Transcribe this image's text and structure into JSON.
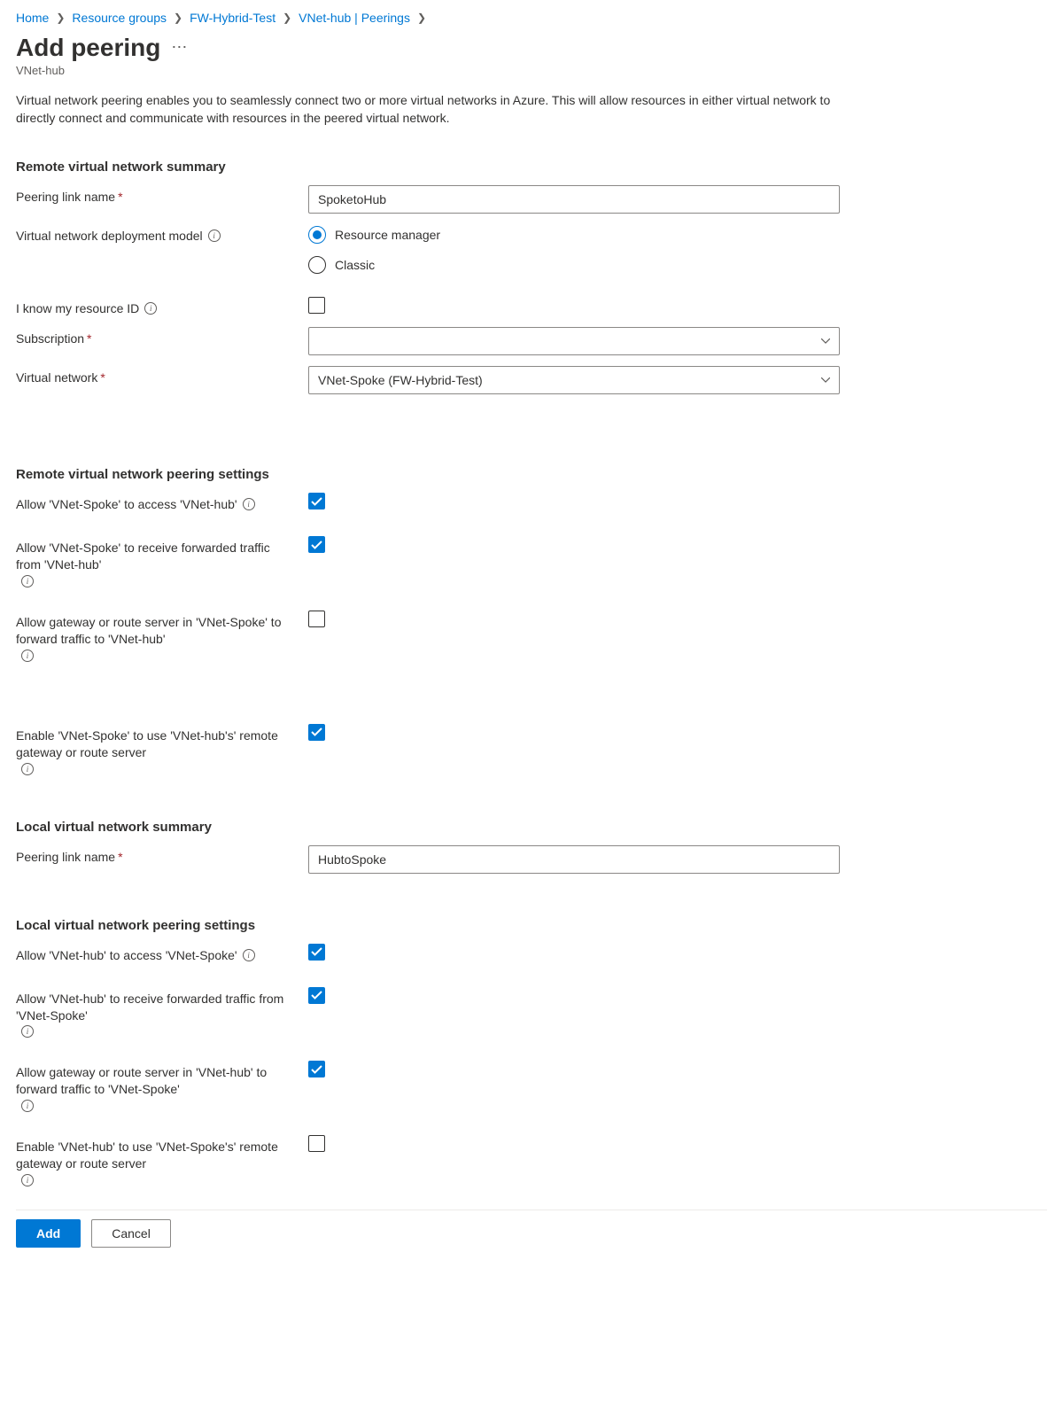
{
  "breadcrumb": [
    {
      "label": "Home"
    },
    {
      "label": "Resource groups"
    },
    {
      "label": "FW-Hybrid-Test"
    },
    {
      "label": "VNet-hub | Peerings"
    }
  ],
  "title": "Add peering",
  "subtitle": "VNet-hub",
  "description": "Virtual network peering enables you to seamlessly connect two or more virtual networks in Azure. This will allow resources in either virtual network to directly connect and communicate with resources in the peered virtual network.",
  "remote_summary": {
    "heading": "Remote virtual network summary",
    "peering_link_label": "Peering link name",
    "peering_link_value": "SpoketoHub",
    "deploy_model_label": "Virtual network deployment model",
    "deploy_model_options": {
      "rm": "Resource manager",
      "classic": "Classic"
    },
    "deploy_model_selected": "rm",
    "know_resource_label": "I know my resource ID",
    "subscription_label": "Subscription",
    "subscription_value": "",
    "vnet_label": "Virtual network",
    "vnet_value": "VNet-Spoke (FW-Hybrid-Test)"
  },
  "remote_settings": {
    "heading": "Remote virtual network peering settings",
    "allow_access_label": "Allow 'VNet-Spoke' to access 'VNet-hub'",
    "allow_access_checked": true,
    "allow_forward_label": "Allow 'VNet-Spoke' to receive forwarded traffic from 'VNet-hub'",
    "allow_forward_checked": true,
    "allow_gateway_label": "Allow gateway or route server in 'VNet-Spoke' to forward traffic to 'VNet-hub'",
    "allow_gateway_checked": false,
    "use_remote_gw_label": "Enable 'VNet-Spoke' to use 'VNet-hub's' remote gateway or route server",
    "use_remote_gw_checked": true
  },
  "local_summary": {
    "heading": "Local virtual network summary",
    "peering_link_label": "Peering link name",
    "peering_link_value": "HubtoSpoke"
  },
  "local_settings": {
    "heading": "Local virtual network peering settings",
    "allow_access_label": "Allow 'VNet-hub' to access 'VNet-Spoke'",
    "allow_access_checked": true,
    "allow_forward_label": "Allow 'VNet-hub' to receive forwarded traffic from 'VNet-Spoke'",
    "allow_forward_checked": true,
    "allow_gateway_label": "Allow gateway or route server in 'VNet-hub' to forward traffic to 'VNet-Spoke'",
    "allow_gateway_checked": true,
    "use_remote_gw_label": "Enable 'VNet-hub' to use 'VNet-Spoke's' remote gateway or route server",
    "use_remote_gw_checked": false
  },
  "buttons": {
    "add": "Add",
    "cancel": "Cancel"
  }
}
